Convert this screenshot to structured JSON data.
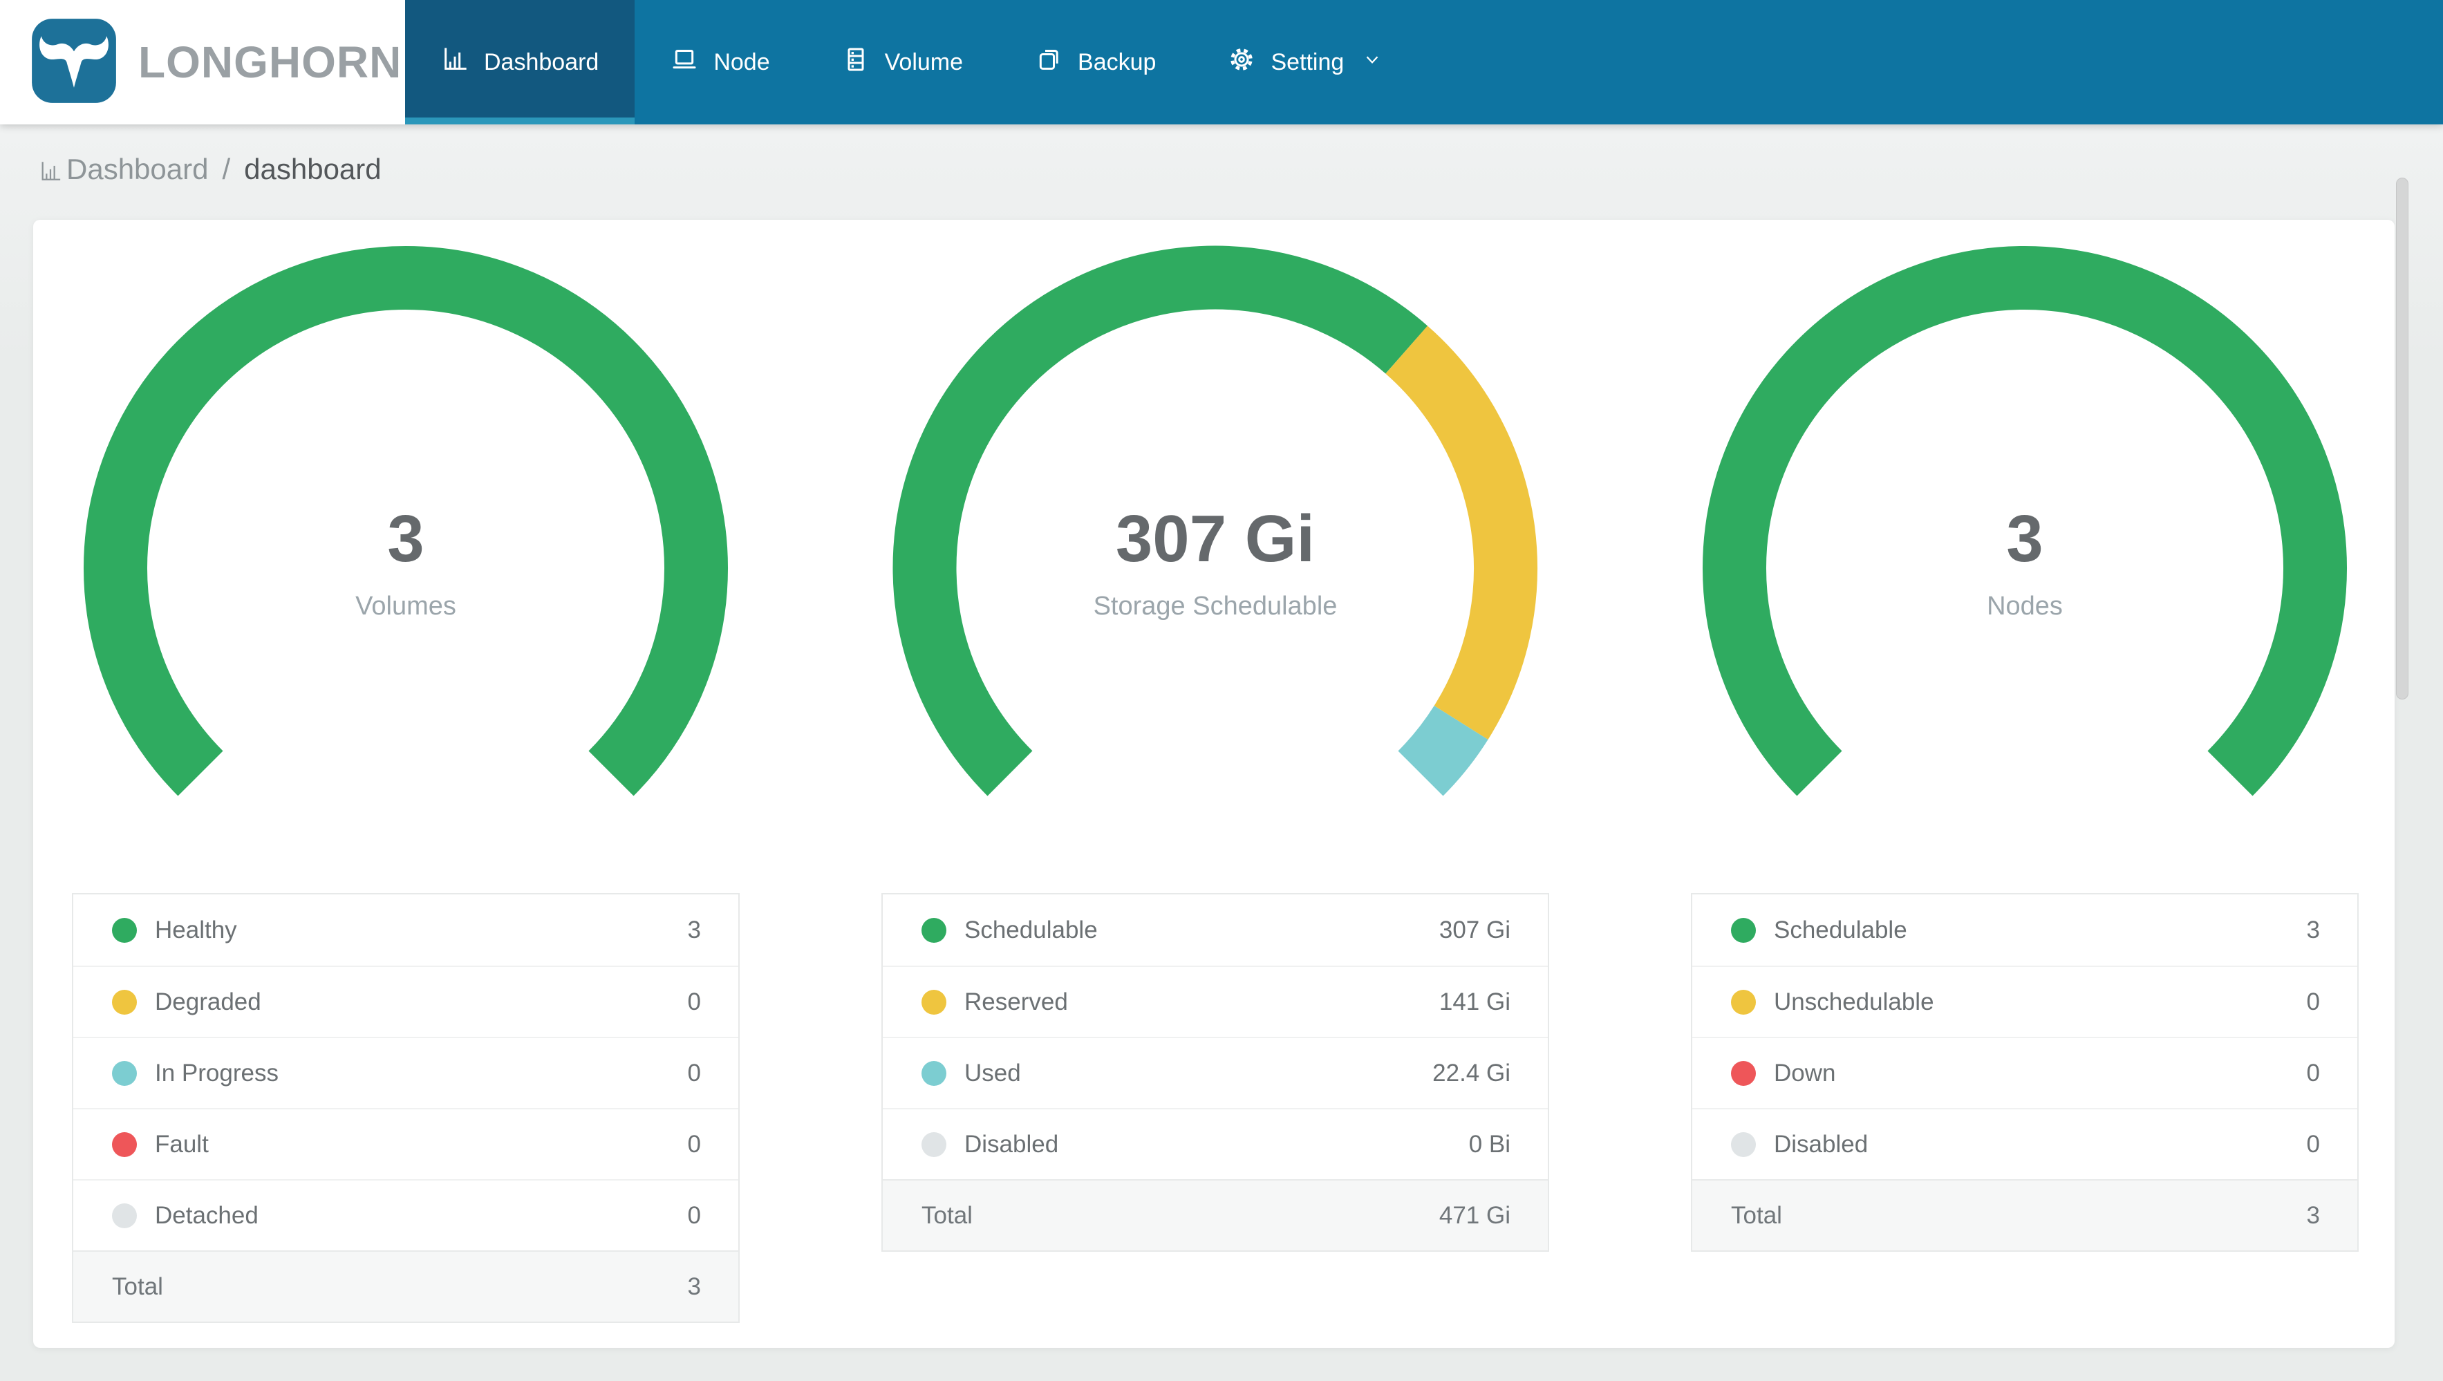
{
  "header": {
    "brand": "LONGHORN",
    "nav": [
      {
        "label": "Dashboard",
        "icon": "bar-chart-icon",
        "active": true
      },
      {
        "label": "Node",
        "icon": "laptop-icon",
        "active": false
      },
      {
        "label": "Volume",
        "icon": "server-stack-icon",
        "active": false
      },
      {
        "label": "Backup",
        "icon": "copy-icon",
        "active": false
      },
      {
        "label": "Setting",
        "icon": "gear-icon",
        "active": false,
        "dropdown": "chevron-down-icon"
      }
    ]
  },
  "breadcrumb": {
    "section": "Dashboard",
    "separator": "/",
    "page": "dashboard",
    "icon": "bar-chart-icon"
  },
  "colors": {
    "nav_bg": "#0e74a1",
    "nav_active_bg": "#12587f",
    "nav_active_underline": "#2b97ba",
    "brand_text": "#9aa0a4",
    "logo_blue": "#1d7199",
    "page_bg": "#e9eceb",
    "card_bg": "#ffffff",
    "green": "#2fab60",
    "yellow": "#efc53f",
    "teal": "#7ccdd1",
    "red": "#ee5659",
    "gray": "#e0e4e6",
    "center_value_text": "#65696c",
    "center_label_text": "#9ba5ab",
    "legend_text": "#6b7073"
  },
  "chart_data": [
    {
      "type": "gauge-donut",
      "arc_degrees": 270,
      "center_value": "3",
      "center_label": "Volumes",
      "segments": [
        {
          "label": "Healthy",
          "value": 3,
          "display": "3",
          "color": "#2fab60"
        },
        {
          "label": "Degraded",
          "value": 0,
          "display": "0",
          "color": "#efc53f"
        },
        {
          "label": "In Progress",
          "value": 0,
          "display": "0",
          "color": "#7ccdd1"
        },
        {
          "label": "Fault",
          "value": 0,
          "display": "0",
          "color": "#ee5659"
        },
        {
          "label": "Detached",
          "value": 0,
          "display": "0",
          "color": "#e0e4e6"
        }
      ],
      "total": {
        "label": "Total",
        "display": "3"
      }
    },
    {
      "type": "gauge-donut",
      "arc_degrees": 270,
      "center_value": "307 Gi",
      "center_label": "Storage Schedulable",
      "segments": [
        {
          "label": "Schedulable",
          "value": 307,
          "display": "307 Gi",
          "color": "#2fab60"
        },
        {
          "label": "Reserved",
          "value": 141,
          "display": "141 Gi",
          "color": "#efc53f"
        },
        {
          "label": "Used",
          "value": 22.4,
          "display": "22.4 Gi",
          "color": "#7ccdd1"
        },
        {
          "label": "Disabled",
          "value": 0,
          "display": "0 Bi",
          "color": "#e0e4e6"
        }
      ],
      "total": {
        "label": "Total",
        "display": "471 Gi"
      }
    },
    {
      "type": "gauge-donut",
      "arc_degrees": 270,
      "center_value": "3",
      "center_label": "Nodes",
      "segments": [
        {
          "label": "Schedulable",
          "value": 3,
          "display": "3",
          "color": "#2fab60"
        },
        {
          "label": "Unschedulable",
          "value": 0,
          "display": "0",
          "color": "#efc53f"
        },
        {
          "label": "Down",
          "value": 0,
          "display": "0",
          "color": "#ee5659"
        },
        {
          "label": "Disabled",
          "value": 0,
          "display": "0",
          "color": "#e0e4e6"
        }
      ],
      "total": {
        "label": "Total",
        "display": "3"
      }
    }
  ]
}
